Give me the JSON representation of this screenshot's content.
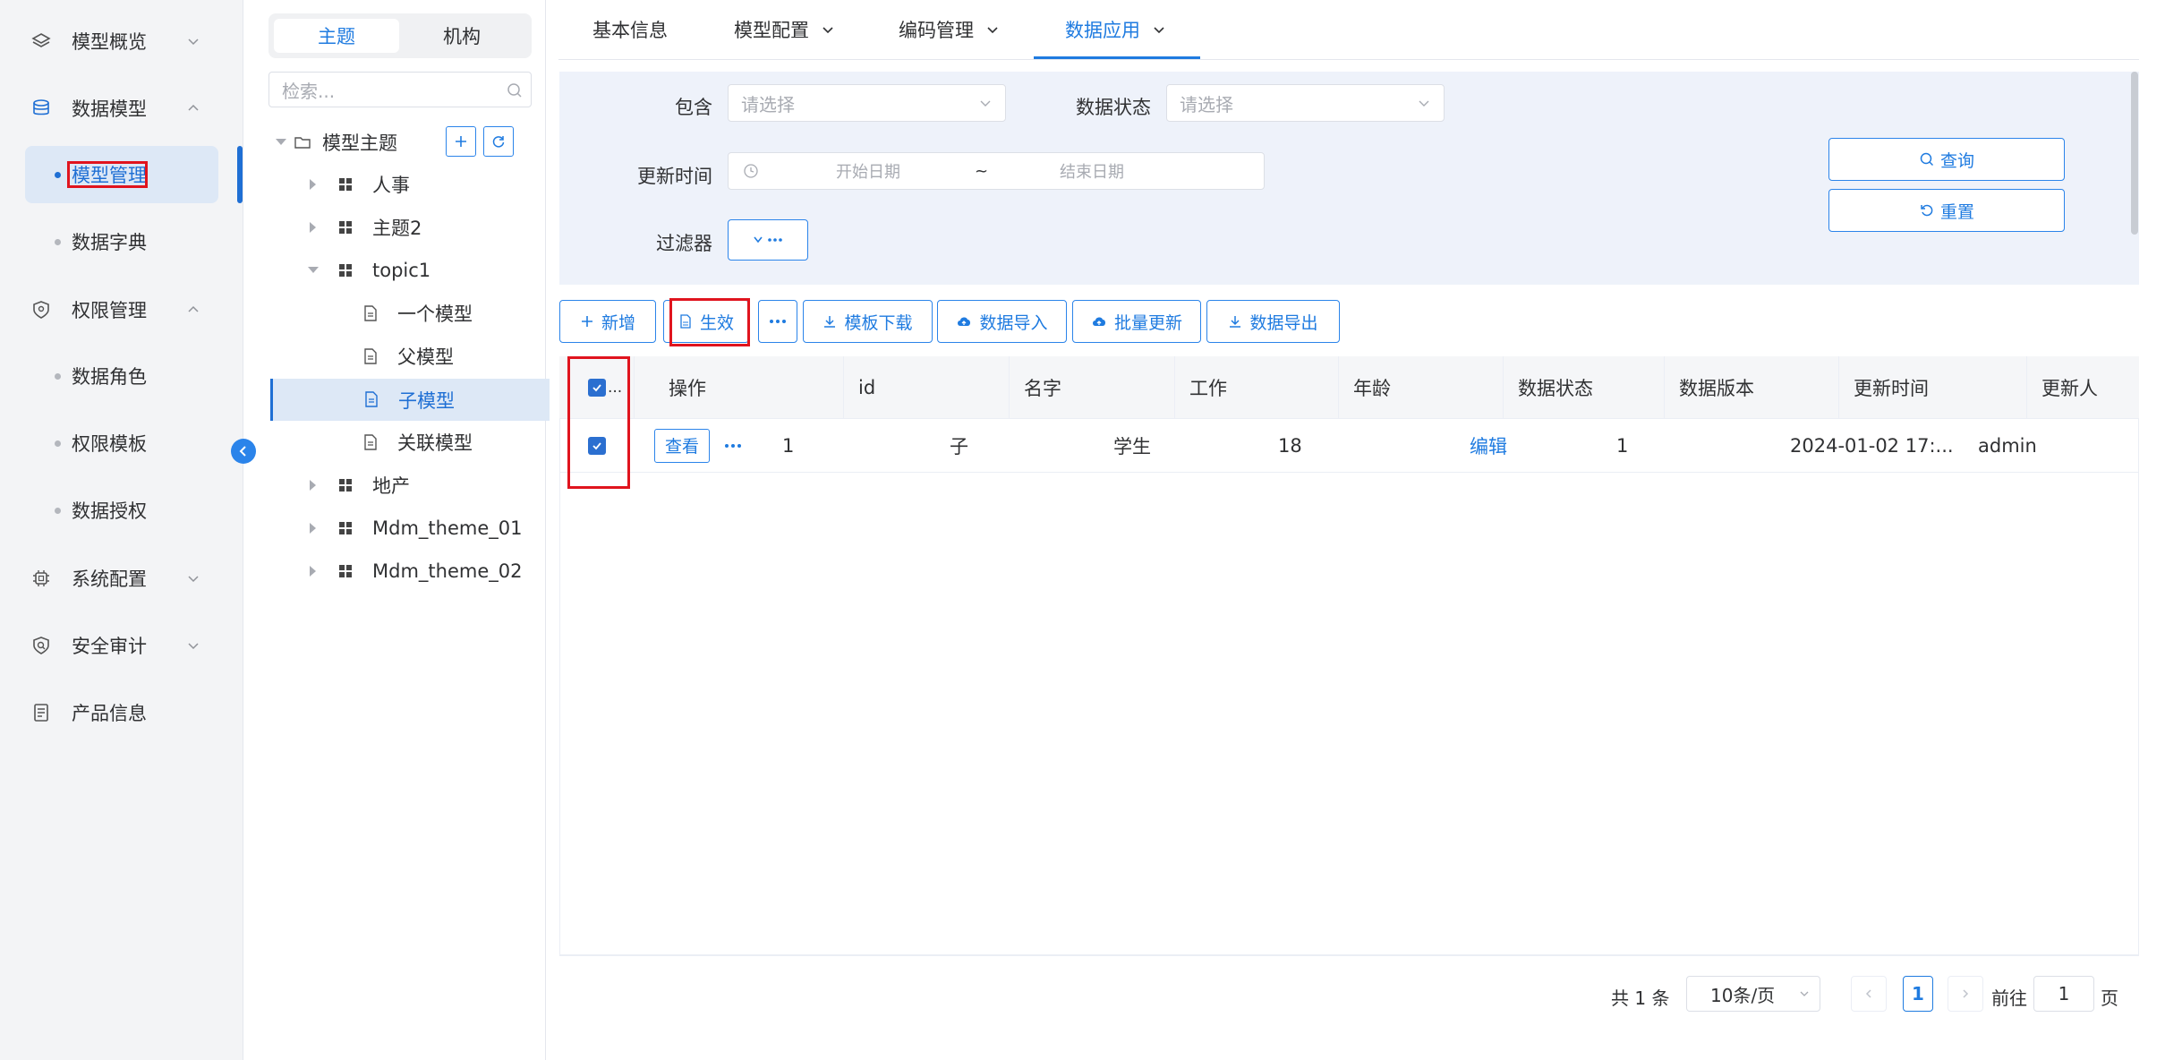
{
  "nav": {
    "items": [
      {
        "label": "模型概览",
        "icon": "layers-icon"
      },
      {
        "label": "数据模型",
        "icon": "database-icon"
      },
      {
        "label": "权限管理",
        "icon": "shield-icon"
      },
      {
        "label": "系统配置",
        "icon": "chip-icon"
      },
      {
        "label": "安全审计",
        "icon": "audit-shield-icon"
      },
      {
        "label": "产品信息",
        "icon": "document-icon"
      }
    ],
    "data_model_children": [
      "模型管理",
      "数据字典"
    ],
    "permission_children": [
      "数据角色",
      "权限模板",
      "数据授权"
    ]
  },
  "tree": {
    "tabs": [
      "主题",
      "机构"
    ],
    "search_placeholder": "检索...",
    "root": "模型主题",
    "nodes": [
      "人事",
      "主题2",
      "topic1",
      "一个模型",
      "父模型",
      "子模型",
      "关联模型",
      "地产",
      "Mdm_theme_01",
      "Mdm_theme_02"
    ]
  },
  "tabs": [
    "基本信息",
    "模型配置",
    "编码管理",
    "数据应用"
  ],
  "filter": {
    "contains_label": "包含",
    "contains_placeholder": "请选择",
    "status_label": "数据状态",
    "status_placeholder": "请选择",
    "time_label": "更新时间",
    "start_placeholder": "开始日期",
    "range_sep": "~",
    "end_placeholder": "结束日期",
    "filter_label": "过滤器",
    "query_btn": "查询",
    "reset_btn": "重置"
  },
  "toolbar": {
    "add": "新增",
    "effective": "生效",
    "template_download": "模板下载",
    "import": "数据导入",
    "batch_update": "批量更新",
    "export": "数据导出"
  },
  "table": {
    "headers": [
      "操作",
      "id",
      "名字",
      "工作",
      "年龄",
      "数据状态",
      "数据版本",
      "更新时间",
      "更新人"
    ],
    "select_all_suffix": "...",
    "rows": [
      {
        "view": "查看",
        "id": "1",
        "name": "子",
        "job": "学生",
        "age": "18",
        "status": "编辑",
        "version": "1",
        "updated": "2024-01-02 17:...",
        "updater": "admin"
      }
    ]
  },
  "pagination": {
    "total": "共 1 条",
    "page_size": "10条/页",
    "current": "1",
    "goto_label": "前往",
    "goto_value": "1",
    "page_suffix": "页"
  },
  "colors": {
    "accent": "#1f7be0",
    "highlight": "#e0141e"
  }
}
